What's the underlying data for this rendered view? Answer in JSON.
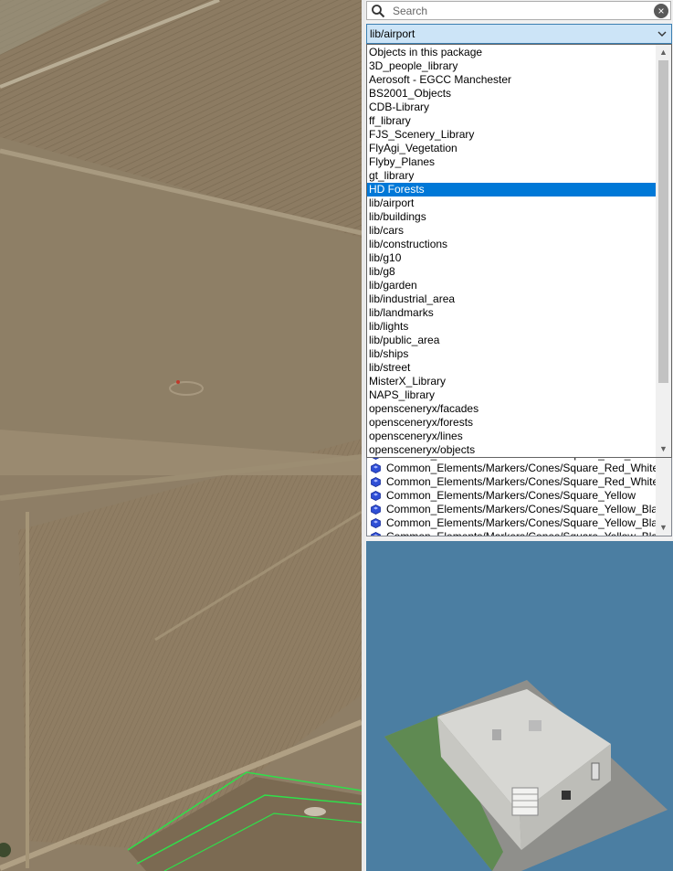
{
  "search": {
    "placeholder": "Search",
    "value": ""
  },
  "package_select": {
    "value": "lib/airport"
  },
  "dropdown": {
    "options": [
      "Objects in this package",
      "3D_people_library",
      "Aerosoft - EGCC Manchester",
      "BS2001_Objects",
      "CDB-Library",
      "ff_library",
      "FJS_Scenery_Library",
      "FlyAgi_Vegetation",
      "Flyby_Planes",
      "gt_library",
      "HD Forests",
      "lib/airport",
      "lib/buildings",
      "lib/cars",
      "lib/constructions",
      "lib/g10",
      "lib/g8",
      "lib/garden",
      "lib/industrial_area",
      "lib/landmarks",
      "lib/lights",
      "lib/public_area",
      "lib/ships",
      "lib/street",
      "MisterX_Library",
      "NAPS_library",
      "opensceneryx/facades",
      "opensceneryx/forests",
      "opensceneryx/lines",
      "opensceneryx/objects"
    ],
    "highlighted": "HD Forests"
  },
  "object_list": {
    "items": [
      "Common_Elements/Markers/Cones/Square_Red_White_",
      "Common_Elements/Markers/Cones/Square_Red_White_",
      "Common_Elements/Markers/Cones/Square_Red_White_",
      "Common_Elements/Markers/Cones/Square_Yellow",
      "Common_Elements/Markers/Cones/Square_Yellow_Blac",
      "Common_Elements/Markers/Cones/Square_Yellow_Blac",
      "Common_Elements/Markers/Cones/Square_Yellow_Bla"
    ],
    "item_icon": "object-icon"
  },
  "icons": [
    "search-icon",
    "clear-search-icon",
    "dropdown-arrow-icon",
    "scroll-up-arrow-icon",
    "scroll-down-arrow-icon",
    "object-icon"
  ],
  "colors": {
    "selection": "#0078d7",
    "combo_bg": "#cce4f7",
    "preview_bg": "#4b7ea2",
    "map_boundary": "#2fe04a"
  }
}
